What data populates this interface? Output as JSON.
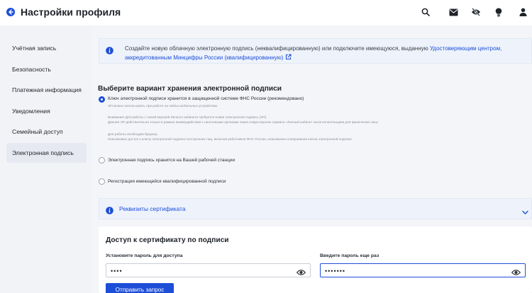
{
  "header": {
    "title": "Настройки профиля",
    "icons": [
      "search-icon",
      "mail-icon",
      "eye-off-icon",
      "lightbulb-icon",
      "user-icon"
    ]
  },
  "sidebar": {
    "items": [
      {
        "label": "Учётная запись",
        "active": false
      },
      {
        "label": "Безопасность",
        "active": false
      },
      {
        "label": "Платежная информация",
        "active": false
      },
      {
        "label": "Уведомления",
        "active": false
      },
      {
        "label": "Семейный доступ",
        "active": false
      },
      {
        "label": "Электронная подпись",
        "active": true
      }
    ]
  },
  "info": {
    "text": "Создайте новую облачную электронную подпись (неквалифицированную) или подключите имеющуюся, выданную ",
    "link": "Удостоверяющим центром, аккредитованным Минцифры России (квалифицированную)"
  },
  "storage": {
    "title": "Выберите вариант хранения электронной подписи",
    "options": [
      {
        "label": "Ключ электронной подписи хранится в защищенной системе ФНС России (рекомендовано)",
        "checked": true,
        "hints": [
          "ЭП можно использовать при работе на любых мобильных устройствах",
          "Внимание! Для работы с новой версией Личного кабинета требуется новая электронная подпись (ЭП).",
          "Данная ЭП действительна только в рамках взаимодействия с налоговыми органами через новую версию сервиса «Личный кабинет налогоплательщика для физических лиц»",
          "Для работы необходим браузер.",
          "Невозможен доступ к ключу электронной подписи посторонних лиц, включая работников ФНС России, невозможно копирование ключа электронной подписи"
        ]
      },
      {
        "label": "Электронная подпись хранится на Вашей рабочей станции",
        "checked": false
      },
      {
        "label": "Регистрация имеющейся квалифицированной подписи",
        "checked": false
      }
    ]
  },
  "details": {
    "label": "Реквизиты сертификата"
  },
  "access": {
    "title": "Доступ к сертификату по подписи",
    "password_label": "Установите пароль для доступа",
    "password_value": "••••",
    "repeat_label": "Введите пароль еще раз",
    "repeat_value": "•••••••",
    "submit_label": "Отправить запрос"
  },
  "colors": {
    "accent": "#1d4ed8",
    "sidebar_bg": "#f2f3f6",
    "info_bg": "#eef3fb"
  }
}
